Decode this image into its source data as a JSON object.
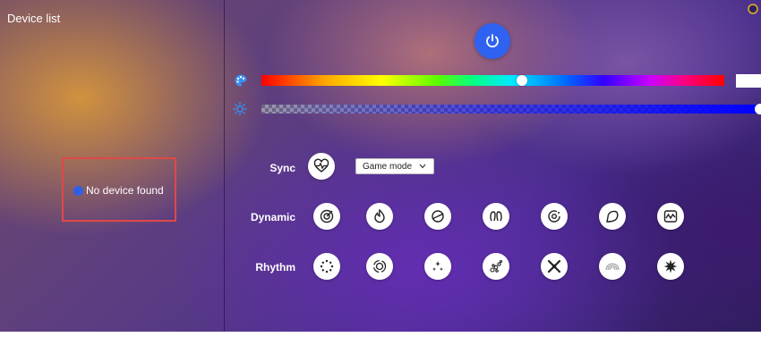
{
  "device_panel": {
    "title": "Device list",
    "status": "No device found"
  },
  "color": {
    "hue_fraction": 0.56,
    "brightness_fraction": 1.0,
    "swatch": "#ffffff",
    "accent": "#2f62f0"
  },
  "sync": {
    "label": "Sync",
    "mode_value": "Game mode"
  },
  "dynamic": {
    "label": "Dynamic",
    "effects": [
      "dynamic-effect-1-icon",
      "dynamic-effect-2-icon",
      "dynamic-effect-3-icon",
      "dynamic-effect-4-icon",
      "dynamic-effect-5-icon",
      "dynamic-effect-6-icon",
      "dynamic-effect-7-icon"
    ]
  },
  "rhythm": {
    "label": "Rhythm",
    "effects": [
      "rhythm-effect-1-icon",
      "rhythm-effect-2-icon",
      "rhythm-effect-3-icon",
      "rhythm-effect-4-icon",
      "rhythm-effect-5-icon",
      "rhythm-effect-6-icon",
      "rhythm-effect-7-icon"
    ]
  },
  "icons": [
    "power-icon",
    "palette-icon",
    "brightness-icon",
    "heart-sync-icon",
    "chevron-down-icon"
  ]
}
